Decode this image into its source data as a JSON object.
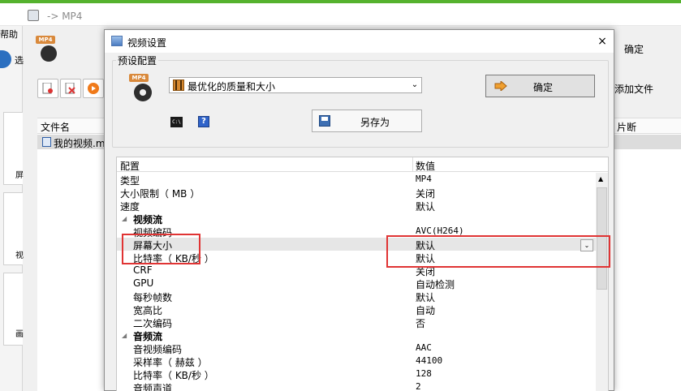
{
  "background_window": {
    "title": "-> MP4",
    "menu_help": "帮助",
    "select_label": "选",
    "side_tiles": [
      "屏",
      "视",
      "画"
    ],
    "file_list_header": "文件名",
    "file_name": "我的视频.m",
    "right_confirm": "确定",
    "right_add_file": "添加文件",
    "right_header": "片断"
  },
  "dialog": {
    "title": "视频设置",
    "close_label": "×",
    "preset_group_label": "预设配置",
    "preset_icon_badge": "MP4",
    "preset_selected": "最优化的质量和大小",
    "confirm_label": "确定",
    "cmd_icon_text": "C:\\",
    "help_icon_text": "?",
    "save_as_label": "另存为",
    "grid": {
      "col_config": "配置",
      "col_value": "数值",
      "rows": [
        {
          "key": "类型",
          "value": "MP4"
        },
        {
          "key": "大小限制（ MB ）",
          "value": "关闭"
        },
        {
          "key": "速度",
          "value": "默认"
        },
        {
          "key": "视频流",
          "value": ""
        },
        {
          "key": "视频编码",
          "value": "AVC(H264)"
        },
        {
          "key": "屏幕大小",
          "value": "默认"
        },
        {
          "key": "比特率（ KB/秒 ）",
          "value": "默认"
        },
        {
          "key": "CRF",
          "value": "关闭"
        },
        {
          "key": "GPU",
          "value": "自动检测"
        },
        {
          "key": "每秒帧数",
          "value": "默认"
        },
        {
          "key": "宽高比",
          "value": "自动"
        },
        {
          "key": "二次编码",
          "value": "否"
        },
        {
          "key": "音频流",
          "value": ""
        },
        {
          "key": "音视频编码",
          "value": "AAC"
        },
        {
          "key": "采样率（ 赫兹 ）",
          "value": "44100"
        },
        {
          "key": "比特率（ KB/秒 ）",
          "value": "128"
        },
        {
          "key": "音频声道",
          "value": "2"
        }
      ]
    }
  },
  "colors": {
    "highlight": "#e03434",
    "accent_green": "#55b22e"
  }
}
